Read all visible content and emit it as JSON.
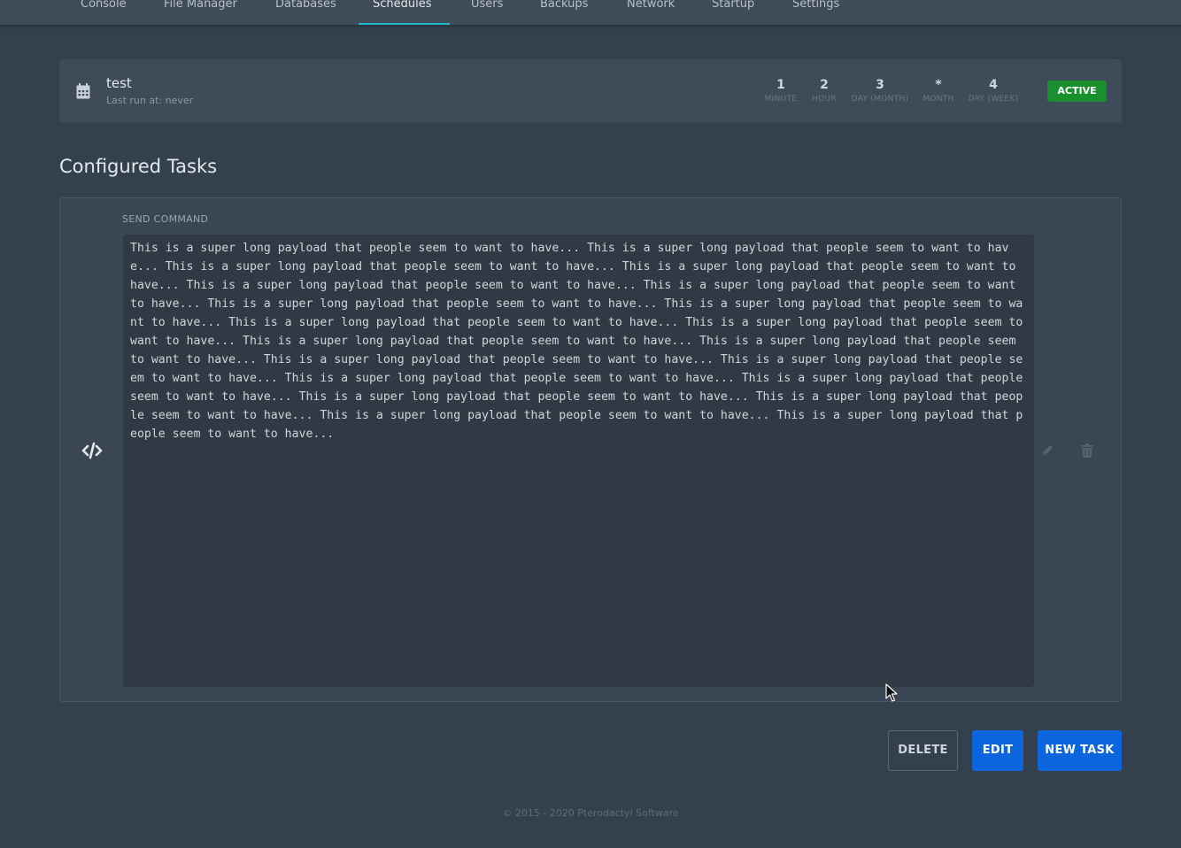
{
  "nav": {
    "tabs": [
      {
        "label": "Console",
        "active": false
      },
      {
        "label": "File Manager",
        "active": false
      },
      {
        "label": "Databases",
        "active": false
      },
      {
        "label": "Schedules",
        "active": true
      },
      {
        "label": "Users",
        "active": false
      },
      {
        "label": "Backups",
        "active": false
      },
      {
        "label": "Network",
        "active": false
      },
      {
        "label": "Startup",
        "active": false
      },
      {
        "label": "Settings",
        "active": false
      }
    ]
  },
  "schedule": {
    "icon": "calendar-icon",
    "name": "test",
    "last_run": "Last run at: never",
    "cron": [
      {
        "value": "1",
        "label": "MINUTE"
      },
      {
        "value": "2",
        "label": "HOUR"
      },
      {
        "value": "3",
        "label": "DAY (MONTH)"
      },
      {
        "value": "*",
        "label": "MONTH"
      },
      {
        "value": "4",
        "label": "DAY (WEEK)"
      }
    ],
    "status": "ACTIVE",
    "status_color": "#1a8f2e"
  },
  "section_title": "Configured Tasks",
  "task": {
    "icon": "code-icon",
    "action_label": "SEND COMMAND",
    "payload_unit": "This is a super long payload that people seem to want to have...",
    "payload_repeat": 20,
    "edit_icon": "pencil-icon",
    "delete_icon": "trash-icon"
  },
  "buttons": {
    "delete": "DELETE",
    "edit": "EDIT",
    "new_task": "NEW TASK"
  },
  "colors": {
    "accent": "#0c65dd",
    "tab_active_underline": "#22b8c9"
  },
  "footer": "© 2015 - 2020 Pterodactyl Software"
}
